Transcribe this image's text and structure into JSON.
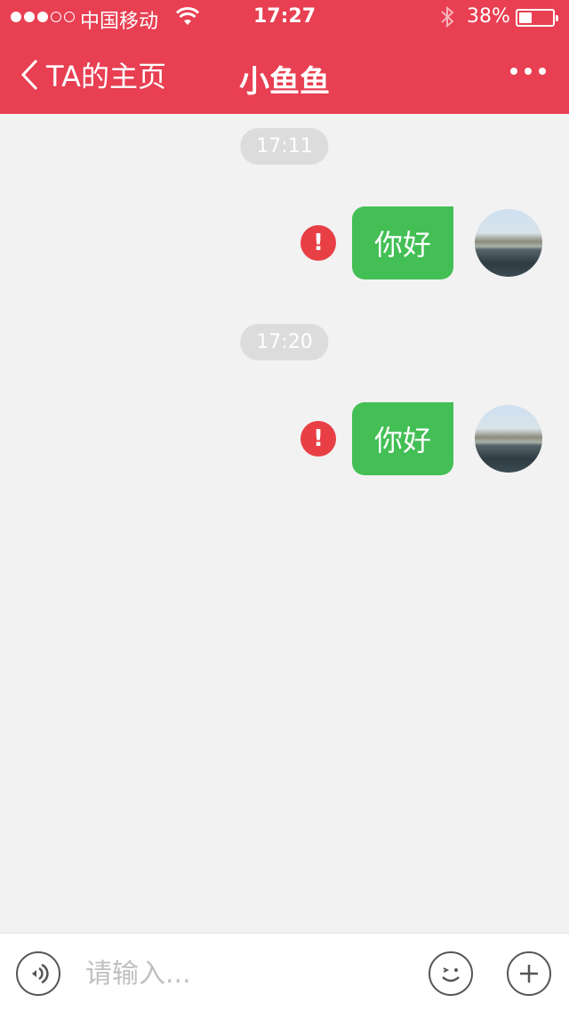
{
  "status_bar": {
    "carrier": "中国移动",
    "time": "17:27",
    "battery_percent": "38%",
    "battery_level": 0.38,
    "signal_strength": 3
  },
  "nav": {
    "back_label": "TA的主页",
    "title": "小鱼鱼",
    "more_icon": "ellipsis-icon"
  },
  "messages": [
    {
      "timestamp": "17:11",
      "text": "你好",
      "status": "failed"
    },
    {
      "timestamp": "17:20",
      "text": "你好",
      "status": "failed"
    }
  ],
  "input_bar": {
    "placeholder": "请输入...",
    "value": "",
    "voice_icon": "voice-icon",
    "emoji_icon": "emoji-icon",
    "plus_icon": "plus-icon"
  },
  "colors": {
    "header": "#e83f52",
    "bubble": "#43bf55",
    "error": "#e83f45",
    "background": "#f2f2f2"
  }
}
